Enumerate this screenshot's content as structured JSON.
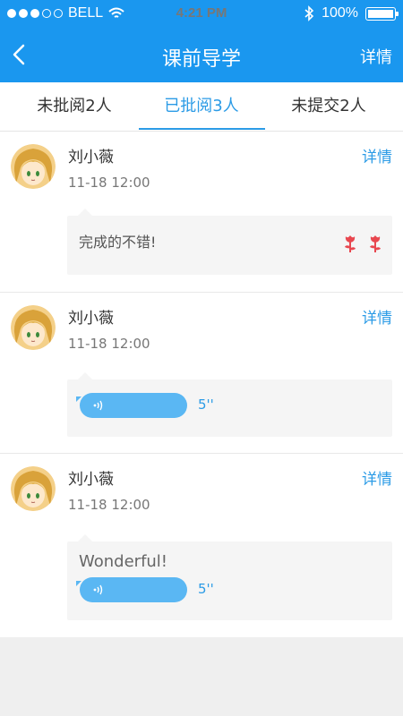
{
  "status_bar": {
    "carrier": "BELL",
    "time": "4:21 PM",
    "battery": "100%",
    "signal_icon": "signal-dots-icon",
    "wifi_icon": "wifi-icon",
    "bluetooth_icon": "bluetooth-icon",
    "battery_icon": "battery-icon"
  },
  "nav": {
    "title": "课前导学",
    "detail": "详情",
    "back_icon": "chevron-left-icon"
  },
  "tabs": [
    {
      "label": "未批阅2人",
      "active": false
    },
    {
      "label": "已批阅3人",
      "active": true
    },
    {
      "label": "未提交2人",
      "active": false
    }
  ],
  "items": [
    {
      "name": "刘小薇",
      "time": "11-18  12:00",
      "detail": "详情",
      "comment": "完成的不错!",
      "flowers": 2
    },
    {
      "name": "刘小薇",
      "time": "11-18  12:00",
      "detail": "详情",
      "voice_duration": "5''"
    },
    {
      "name": "刘小薇",
      "time": "11-18  12:00",
      "detail": "详情",
      "comment": "Wonderful!",
      "voice_duration": "5''"
    }
  ],
  "colors": {
    "brand": "#1a97ef",
    "accent": "#2b9be6",
    "voice": "#5ab7f3",
    "flower": "#e8474f"
  }
}
